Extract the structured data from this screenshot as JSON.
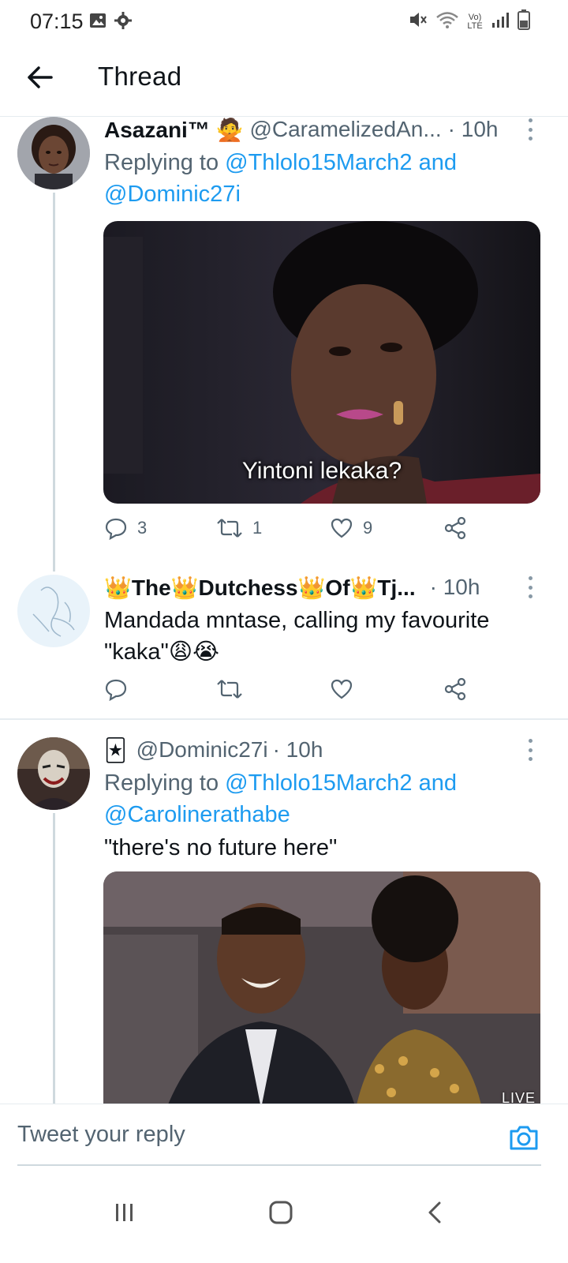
{
  "status_bar": {
    "time": "07:15",
    "left_icons": [
      "image-icon",
      "gear-icon"
    ],
    "right_icons": [
      "mute-icon",
      "wifi-icon",
      "volte-icon",
      "signal-icon",
      "battery-icon"
    ],
    "volte_label": "Vo) LTE"
  },
  "header": {
    "title": "Thread"
  },
  "tweets": [
    {
      "name": "Asazani™ 🙅",
      "handle": "@CaramelizedAn...",
      "time": "· 10h",
      "replying_prefix": "Replying to",
      "replying_to_1": "@Thlolo15March2",
      "replying_joiner": "and",
      "replying_to_2": "@Dominic27i",
      "media_caption": "Yintoni lekaka?",
      "reply_count": "3",
      "retweet_count": "1",
      "like_count": "9"
    },
    {
      "name": "👑The👑Dutchess👑Of👑Tj...",
      "time": "· 10h",
      "text": "Mandada mntase, calling my favourite \"kaka\"😩😭"
    },
    {
      "name": "🃏",
      "handle": "@Dominic27i",
      "time": "· 10h",
      "replying_prefix": "Replying to",
      "replying_to_1": "@Thlolo15March2",
      "replying_joiner": "and",
      "replying_to_2": "@Carolinerathabe",
      "text": "\"there's no future here\"",
      "media_badge": "LIVE"
    }
  ],
  "reply_bar": {
    "placeholder": "Tweet your reply"
  },
  "nav_bar": {
    "buttons": [
      "recent-apps",
      "home",
      "back"
    ]
  },
  "colors": {
    "link": "#1d9bf0",
    "secondary_text": "#536471",
    "divider": "#e6ecf0"
  }
}
